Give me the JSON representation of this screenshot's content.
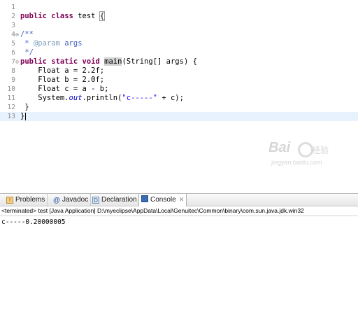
{
  "editor": {
    "lines": [
      {
        "num": "1",
        "fold": "",
        "tokens": []
      },
      {
        "num": "2",
        "fold": "",
        "tokens": [
          {
            "t": "public",
            "c": "kw"
          },
          {
            "t": " "
          },
          {
            "t": "class",
            "c": "kw"
          },
          {
            "t": " test "
          },
          {
            "t": "{",
            "c": "brace-box"
          }
        ]
      },
      {
        "num": "3",
        "fold": "",
        "tokens": []
      },
      {
        "num": "4",
        "fold": "⊖",
        "tokens": [
          {
            "t": "/**",
            "c": "cm"
          }
        ]
      },
      {
        "num": "5",
        "fold": "",
        "tokens": [
          {
            "t": " * ",
            "c": "cm"
          },
          {
            "t": "@param",
            "c": "jt"
          },
          {
            "t": " args",
            "c": "cm"
          }
        ]
      },
      {
        "num": "6",
        "fold": "",
        "tokens": [
          {
            "t": " */",
            "c": "cm"
          }
        ]
      },
      {
        "num": "7",
        "fold": "⊖",
        "tokens": [
          {
            "t": "public",
            "c": "kw"
          },
          {
            "t": " "
          },
          {
            "t": "static",
            "c": "kw"
          },
          {
            "t": " "
          },
          {
            "t": "void",
            "c": "kw"
          },
          {
            "t": " "
          },
          {
            "t": "main",
            "c": "hl"
          },
          {
            "t": "(String[] args) {"
          }
        ]
      },
      {
        "num": "8",
        "fold": "",
        "tokens": [
          {
            "t": "    Float a = 2.2f;"
          }
        ]
      },
      {
        "num": "9",
        "fold": "",
        "tokens": [
          {
            "t": "    Float b = 2.0f;"
          }
        ]
      },
      {
        "num": "10",
        "fold": "",
        "tokens": [
          {
            "t": "    Float c = a - b;"
          }
        ]
      },
      {
        "num": "11",
        "fold": "",
        "tokens": [
          {
            "t": "    System."
          },
          {
            "t": "out",
            "c": "fld"
          },
          {
            "t": ".println("
          },
          {
            "t": "\"c-----\"",
            "c": "str"
          },
          {
            "t": " + c);"
          }
        ]
      },
      {
        "num": "12",
        "fold": "",
        "tokens": [
          {
            "t": " }"
          }
        ]
      },
      {
        "num": "13",
        "fold": "",
        "tokens": [
          {
            "t": "}"
          }
        ],
        "current": true,
        "caret": true
      }
    ]
  },
  "watermark": {
    "main": "Bai",
    "cn": "经验",
    "sub": "jingyan.baidu.com"
  },
  "console_view": {
    "tabs": [
      {
        "name": "tab-problems",
        "icon": "problems-icon",
        "glyph": "!",
        "icon_class": "ico-problems",
        "label": "Problems"
      },
      {
        "name": "tab-javadoc",
        "icon": "javadoc-icon",
        "glyph": "@",
        "icon_class": "ico-javadoc",
        "label": "Javadoc"
      },
      {
        "name": "tab-declaration",
        "icon": "declaration-icon",
        "glyph": "D",
        "icon_class": "ico-decl",
        "label": "Declaration"
      },
      {
        "name": "tab-console",
        "icon": "console-icon",
        "glyph": "",
        "icon_class": "ico-console",
        "label": "Console",
        "active": true,
        "close": "✕"
      }
    ],
    "terminated_line": "<terminated> test [Java Application] D:\\myeclipse\\AppData\\Local\\Genuitec\\Common\\binary\\com.sun.java.jdk.win32",
    "output": "c-----0.20000005"
  },
  "colors": {
    "keyword": "#7f0055",
    "comment": "#3f5fbf",
    "javadoc_tag": "#7f9fbf",
    "string": "#2a00ff",
    "field": "#0000c0",
    "current_line": "#e8f2fe"
  }
}
